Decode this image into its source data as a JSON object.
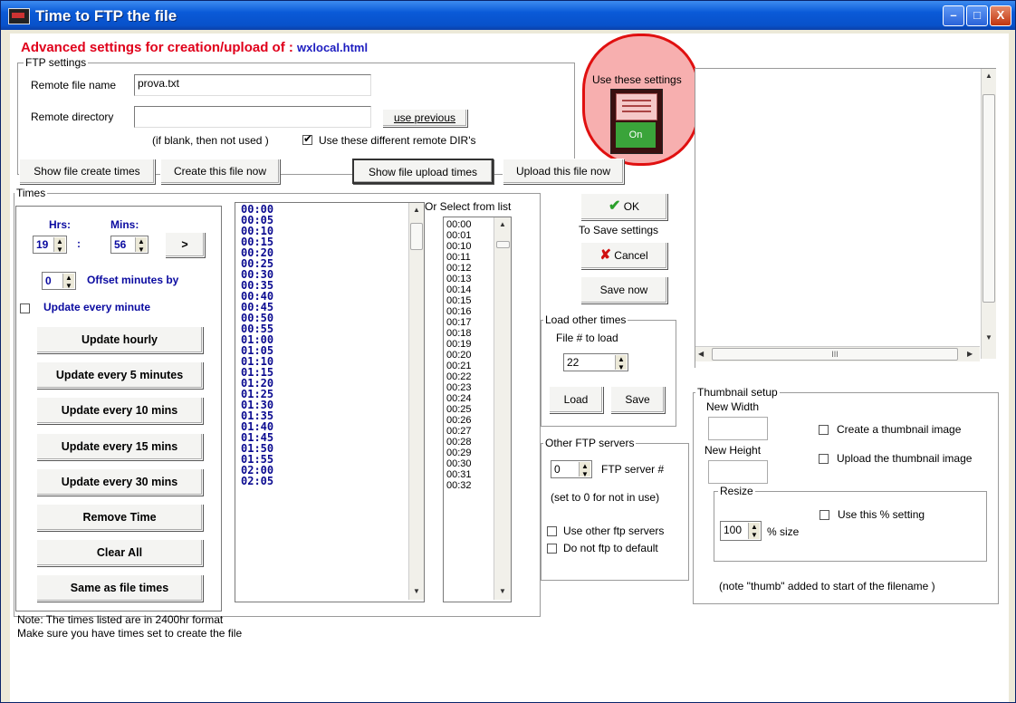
{
  "window": {
    "title": "Time to FTP the file",
    "min": "–",
    "max": "□",
    "close": "X"
  },
  "header": {
    "heading": "Advanced settings for creation/upload of : ",
    "filename": "wxlocal.html"
  },
  "ftp": {
    "legend": "FTP settings",
    "remote_name_label": "Remote file name",
    "remote_name_value": "prova.txt",
    "remote_dir_label": "Remote directory",
    "remote_dir_value": "",
    "use_previous": "use previous",
    "blank_note": "(if blank, then not used )",
    "diff_dirs_label": "Use these different remote DIR's",
    "diff_dirs_checked": true
  },
  "use_settings": {
    "label": "Use these settings",
    "state": "On"
  },
  "actions": {
    "show_create": "Show file create times",
    "create_now": "Create this file now",
    "show_upload": "Show file upload times",
    "upload_now": "Upload this file now"
  },
  "times": {
    "legend": "Times",
    "hrs_label": "Hrs:",
    "mins_label": "Mins:",
    "hrs": "19",
    "mins": "56",
    "add": ">",
    "colon": ":",
    "offset": "0",
    "offset_label": "Offset minutes by",
    "update_every_minute": "Update every minute",
    "buttons": [
      "Update hourly",
      "Update every 5 minutes",
      "Update every 10 mins",
      "Update every 15 mins",
      "Update every 30 mins",
      "Remove Time",
      "Clear All",
      "Same as file times"
    ]
  },
  "time_list": [
    "00:00",
    "00:05",
    "00:10",
    "00:15",
    "00:20",
    "00:25",
    "00:30",
    "00:35",
    "00:40",
    "00:45",
    "00:50",
    "00:55",
    "01:00",
    "01:05",
    "01:10",
    "01:15",
    "01:20",
    "01:25",
    "01:30",
    "01:35",
    "01:40",
    "01:45",
    "01:50",
    "01:55",
    "02:00",
    "02:05"
  ],
  "select_list": {
    "label": "Or Select from list",
    "items": [
      "00:00",
      "00:01",
      "00:10",
      "00:11",
      "00:12",
      "00:13",
      "00:14",
      "00:15",
      "00:16",
      "00:17",
      "00:18",
      "00:19",
      "00:20",
      "00:21",
      "00:22",
      "00:23",
      "00:24",
      "00:25",
      "00:26",
      "00:27",
      "00:28",
      "00:29",
      "00:30",
      "00:31",
      "00:32"
    ]
  },
  "save": {
    "ok": "OK",
    "to_save": "To Save settings",
    "cancel": "Cancel",
    "save_now": "Save now"
  },
  "load_times": {
    "legend": "Load other times",
    "file_label": "File # to load",
    "file_value": "22",
    "load": "Load",
    "save": "Save"
  },
  "other_ftp": {
    "legend": "Other FTP servers",
    "server_value": "0",
    "server_label": "FTP server #",
    "note": "(set to 0 for not in use)",
    "use_other": "Use other ftp servers",
    "no_default": "Do not ftp to default"
  },
  "preview": {
    "hscroll_dots": "III"
  },
  "thumbnail": {
    "legend": "Thumbnail setup",
    "new_width": "New Width",
    "new_height": "New Height",
    "create": "Create a thumbnail image",
    "upload": "Upload the thumbnail image",
    "resize_legend": "Resize",
    "use_percent": "Use this % setting",
    "percent_value": "100",
    "percent_label": "% size",
    "note": "(note \"thumb\" added to start of the filename )"
  },
  "footer": {
    "line1": "Note: The times listed are in 2400hr format",
    "line2": "Make sure you have times set to create the file"
  }
}
